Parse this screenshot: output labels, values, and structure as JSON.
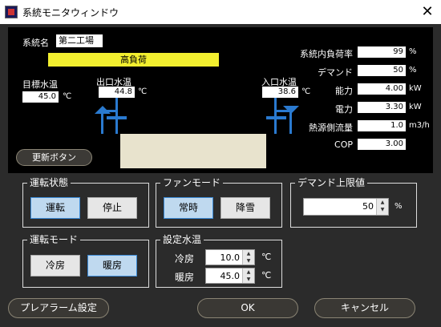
{
  "window": {
    "title": "系統モニタウィンドウ",
    "close": "✕"
  },
  "monitor": {
    "system_label": "系統名",
    "system_name": "第二工場",
    "status": "高負荷",
    "target_temp": {
      "label": "目標水温",
      "value": "45.0",
      "unit": "℃"
    },
    "outlet_temp": {
      "label": "出口水温",
      "value": "44.8",
      "unit": "℃"
    },
    "inlet_temp": {
      "label": "入口水温",
      "value": "38.6",
      "unit": "℃"
    },
    "metrics": [
      {
        "label": "系統内負荷率",
        "value": "99",
        "unit": "%"
      },
      {
        "label": "デマンド",
        "value": "50",
        "unit": "%"
      },
      {
        "label": "能力",
        "value": "4.00",
        "unit": "kW"
      },
      {
        "label": "電力",
        "value": "3.30",
        "unit": "kW"
      },
      {
        "label": "熱源側流量",
        "value": "1.0",
        "unit": "m3/h"
      },
      {
        "label": "COP",
        "value": "3.00",
        "unit": ""
      }
    ],
    "refresh_label": "更新ボタン"
  },
  "operation": {
    "title": "運転状態",
    "run": "運転",
    "stop": "停止"
  },
  "fan": {
    "title": "ファンモード",
    "normal": "常時",
    "snow": "降雪"
  },
  "demand_limit": {
    "title": "デマンド上限値",
    "value": "50",
    "unit": "%"
  },
  "mode": {
    "title": "運転モード",
    "cool": "冷房",
    "heat": "暖房"
  },
  "setpoint": {
    "title": "設定水温",
    "cool_label": "冷房",
    "cool_value": "10.0",
    "heat_label": "暖房",
    "heat_value": "45.0",
    "unit": "℃"
  },
  "footer": {
    "prealarm": "プレアラーム設定",
    "ok": "OK",
    "cancel": "キャンセル"
  },
  "colors": {
    "status_bar": "#f2ef2f",
    "pipe": "#2a7ad0",
    "selected_button": "#bfd9ef"
  }
}
